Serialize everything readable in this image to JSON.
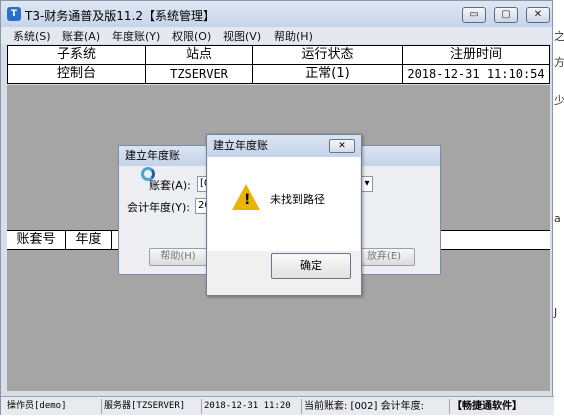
{
  "window": {
    "title": "T3-财务通普及版11.2【系统管理】",
    "controls": {
      "minimize": "▭",
      "maximize": "▢",
      "close": "✕"
    }
  },
  "menu": [
    "系统(S)",
    "账套(A)",
    "年度账(Y)",
    "权限(O)",
    "视图(V)",
    "帮助(H)"
  ],
  "top_table": {
    "headers": [
      "子系统",
      "站点",
      "运行状态",
      "注册时间"
    ],
    "rows": [
      [
        "控制台",
        "TZSERVER",
        "正常(1)",
        "2018-12-31 11:10:54"
      ]
    ]
  },
  "bottom_table": {
    "headers": [
      "账套号",
      "年度"
    ]
  },
  "background_dialog": {
    "title": "建立年度账",
    "account_label": "账套(A):",
    "account_value": "[0",
    "year_label": "会计年度(Y):",
    "year_value": "20",
    "help_button": "帮助(H)",
    "cancel_button": "放弃(E)"
  },
  "message_box": {
    "title": "建立年度账",
    "close_glyph": "✕",
    "message": "未找到路径",
    "ok_button": "确定",
    "icon": "warning-icon"
  },
  "status_bar": [
    "操作员[demo]",
    "服务器[TZSERVER]",
    "2018-12-31 11:20",
    "当前账套: [002] 会计年度:",
    "【畅捷通软件】"
  ],
  "side_text": [
    "之",
    "方",
    "少",
    "a",
    "J"
  ]
}
